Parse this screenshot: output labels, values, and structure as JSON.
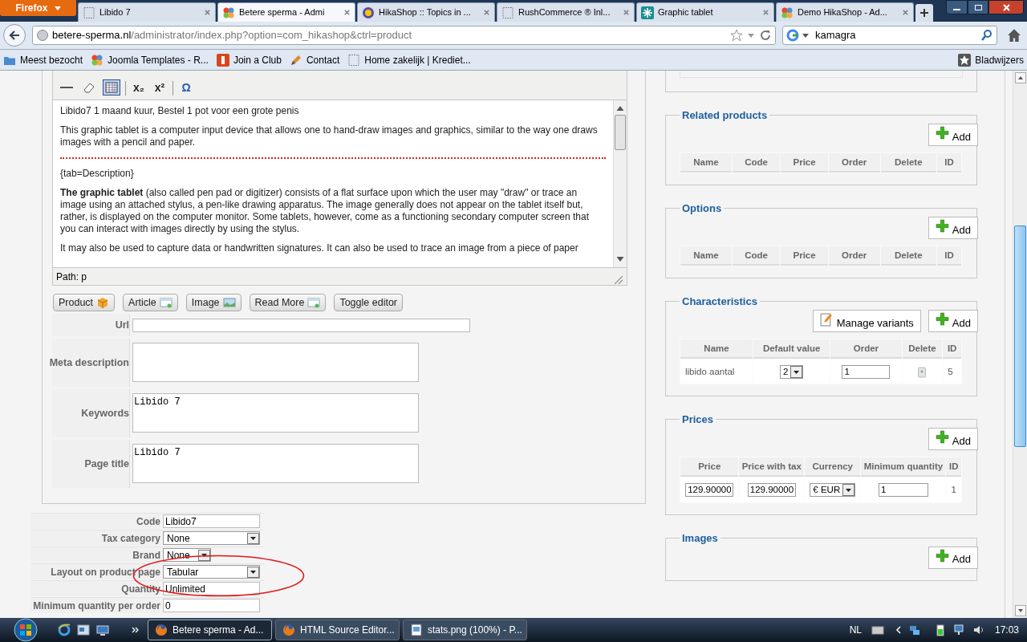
{
  "browser": {
    "menu_button": "Firefox",
    "tabs": [
      {
        "title": "Libido 7",
        "kind": "blank",
        "selected": false
      },
      {
        "title": "Betere sperma - Admi",
        "kind": "joomla",
        "selected": true
      },
      {
        "title": "HikaShop :: Topics in ...",
        "kind": "sun",
        "selected": false
      },
      {
        "title": "RushCommerce ® Inl...",
        "kind": "blank",
        "selected": false
      },
      {
        "title": "Graphic tablet",
        "kind": "star",
        "selected": false
      },
      {
        "title": "Demo HikaShop - Ad...",
        "kind": "joomla",
        "selected": false
      }
    ],
    "address": {
      "host": "betere-sperma.nl",
      "path": "/administrator/index.php?option=com_hikashop&ctrl=product"
    },
    "search": {
      "value": "kamagra"
    },
    "bookmarks": [
      {
        "label": "Meest bezocht",
        "kind": "folder"
      },
      {
        "label": "Joomla Templates - R...",
        "kind": "joomla"
      },
      {
        "label": "Join a Club",
        "kind": "club"
      },
      {
        "label": "Contact",
        "kind": "pen"
      },
      {
        "label": "Home zakelijk | Krediet...",
        "kind": "blank"
      }
    ],
    "bookmarks_menu": "Bladwijzers"
  },
  "editor": {
    "toolbar": [
      {
        "kind": "rule",
        "selected": false
      },
      {
        "kind": "eraser",
        "selected": false
      },
      {
        "kind": "table",
        "selected": true
      },
      {
        "kind": "text",
        "label": "x₂",
        "selected": false
      },
      {
        "kind": "text",
        "label": "x²",
        "selected": false
      },
      {
        "kind": "text",
        "label": "Ω",
        "selected": false
      }
    ],
    "paragraphs": [
      {
        "kind": "text",
        "text": "Libido7 1 maand kuur, Bestel 1 pot voor een grote penis"
      },
      {
        "kind": "text",
        "text": "This graphic tablet is a computer input device that allows one to hand-draw images and graphics, similar to the way one draws images with a pencil and paper."
      },
      {
        "kind": "pagebreak"
      },
      {
        "kind": "text",
        "text": "{tab=Description}"
      },
      {
        "kind": "text",
        "text": "**The graphic tablet** (also called pen pad or digitizer) consists of a flat surface upon which the user may \"draw\" or trace an image using an attached stylus, a pen-like drawing apparatus. The image generally does not appear on the tablet itself but, rather, is displayed on the computer monitor. Some tablets, however, come as a functioning secondary computer screen that you can interact with images directly by using the stylus."
      },
      {
        "kind": "text",
        "text": "It may also be used to capture data or handwritten signatures. It can also be used to trace an image from a piece of paper"
      }
    ],
    "path": "Path: p"
  },
  "editor_buttons": [
    {
      "label": "Product",
      "kind": "box"
    },
    {
      "label": "Article",
      "kind": "doc"
    },
    {
      "label": "Image",
      "kind": "image"
    },
    {
      "label": "Read More",
      "kind": "doc"
    },
    {
      "label": "Toggle editor",
      "kind": "plain"
    }
  ],
  "meta_fields": [
    {
      "label": "Url",
      "kind": "input"
    },
    {
      "label": "Meta description",
      "kind": "textarea"
    },
    {
      "label": "Keywords",
      "kind": "textarea",
      "value": "Libido 7"
    },
    {
      "label": "Page title",
      "kind": "textarea",
      "value": "Libido 7"
    }
  ],
  "product_fields": [
    {
      "label": "Code",
      "kind": "input",
      "value": "Libido7"
    },
    {
      "label": "Tax category",
      "kind": "select",
      "value": "None"
    },
    {
      "label": "Brand",
      "kind": "select_small",
      "value": "None"
    },
    {
      "label": "Layout on product page",
      "kind": "select",
      "value": "Tabular"
    },
    {
      "label": "Quantity",
      "kind": "input",
      "value": "Unlimited"
    },
    {
      "label": "Minimum quantity per order",
      "kind": "input",
      "value": "0"
    }
  ],
  "sections": [
    {
      "title": "Related products",
      "buttons": [
        {
          "label": "Add",
          "kind": "plus"
        }
      ],
      "columns": [
        "Name",
        "Code",
        "Price",
        "Order",
        "Delete",
        "ID"
      ]
    },
    {
      "title": "Options",
      "buttons": [
        {
          "label": "Add",
          "kind": "plus"
        }
      ],
      "columns": [
        "Name",
        "Code",
        "Price",
        "Order",
        "Delete",
        "ID"
      ]
    },
    {
      "title": "Characteristics",
      "buttons": [
        {
          "label": "Manage variants",
          "kind": "edit"
        },
        {
          "label": "Add",
          "kind": "plus"
        }
      ],
      "columns": [
        "Name",
        "Default value",
        "Order",
        "Delete",
        "ID"
      ],
      "rows": [
        [
          {
            "kind": "text",
            "value": "libido aantal"
          },
          {
            "kind": "select",
            "value": "2"
          },
          {
            "kind": "input",
            "value": "1"
          },
          {
            "kind": "trash"
          },
          {
            "kind": "text",
            "value": "5"
          }
        ]
      ]
    },
    {
      "title": "Prices",
      "buttons": [
        {
          "label": "Add",
          "kind": "plus"
        }
      ],
      "columns": [
        "Price",
        "Price with tax",
        "Currency",
        "Minimum quantity",
        "ID"
      ],
      "rows": [
        [
          {
            "kind": "input",
            "value": "129.90000"
          },
          {
            "kind": "input",
            "value": "129.90000"
          },
          {
            "kind": "select",
            "value": "€ EUR"
          },
          {
            "kind": "input_wide",
            "value": "1"
          },
          {
            "kind": "text",
            "value": "1"
          }
        ]
      ]
    },
    {
      "title": "Images",
      "buttons": [
        {
          "label": "Add",
          "kind": "plus"
        }
      ]
    }
  ],
  "taskbar": {
    "tasks": [
      {
        "label": "Betere sperma - Ad...",
        "kind": "firefox",
        "selected": true
      },
      {
        "label": "HTML Source Editor...",
        "kind": "firefox",
        "selected": false
      },
      {
        "label": "stats.png (100%) - P...",
        "kind": "picture",
        "selected": false
      }
    ],
    "language": "NL",
    "time": "17:03"
  }
}
